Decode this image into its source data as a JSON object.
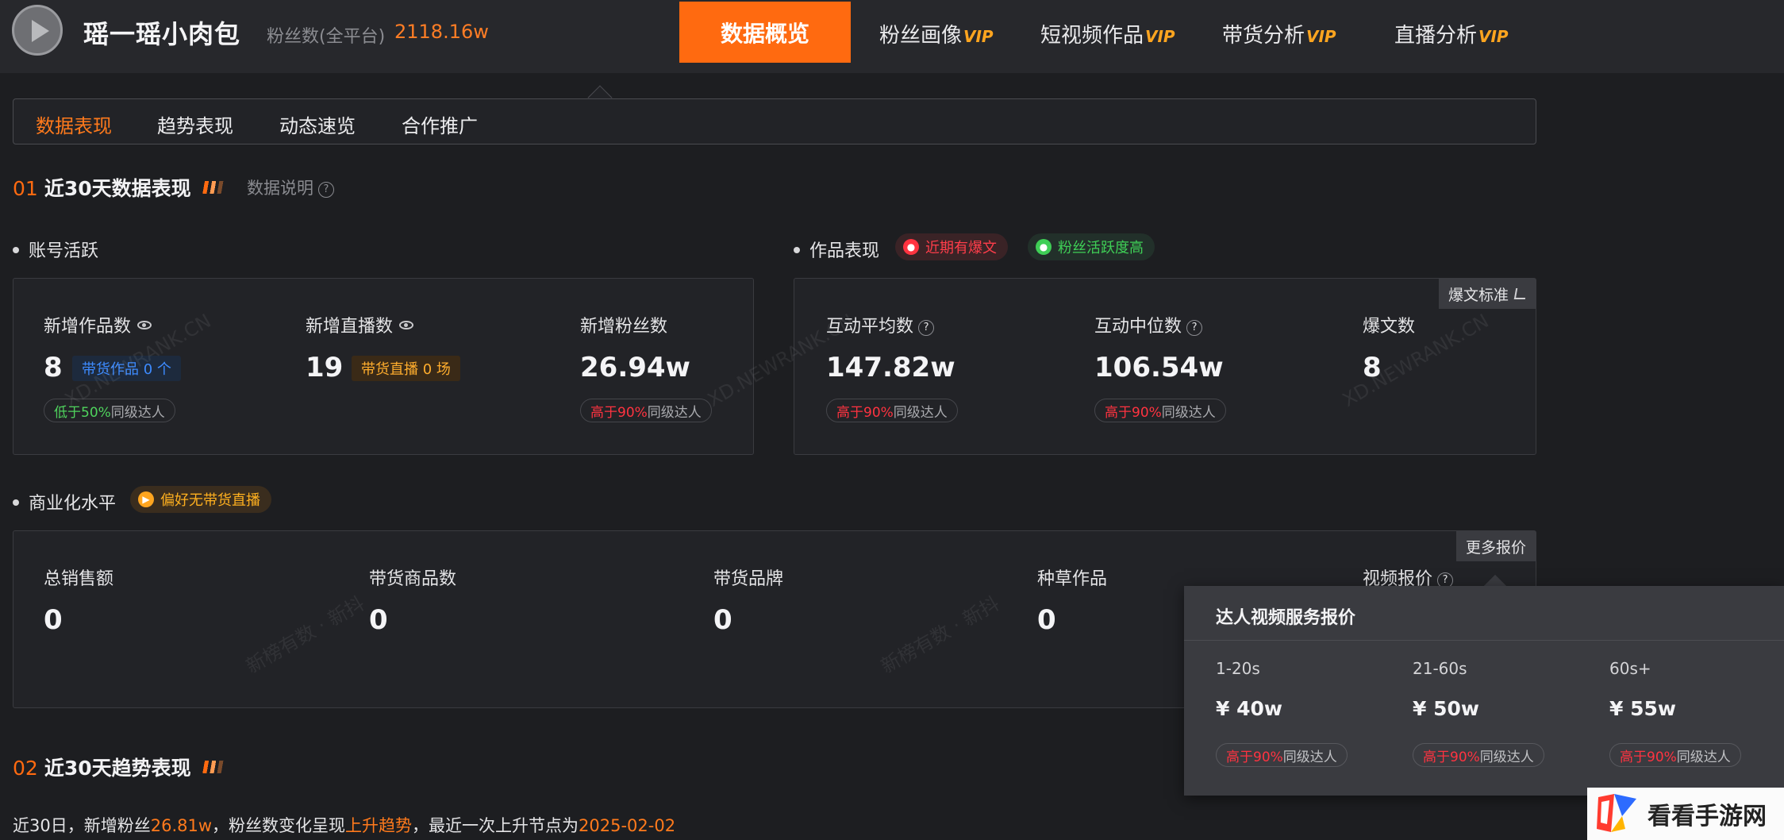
{
  "header": {
    "account_name": "瑶一瑶小肉包",
    "fans_label": "粉丝数(全平台)",
    "fans_value": "2118.16w",
    "nav": [
      {
        "label": "数据概览",
        "vip": ""
      },
      {
        "label": "粉丝画像",
        "vip": "VIP"
      },
      {
        "label": "短视频作品",
        "vip": "VIP"
      },
      {
        "label": "带货分析",
        "vip": "VIP"
      },
      {
        "label": "直播分析",
        "vip": "VIP"
      }
    ]
  },
  "tabs": [
    "数据表现",
    "趋势表现",
    "动态速览",
    "合作推广"
  ],
  "section1": {
    "num": "01",
    "title": "近30天数据表现",
    "note": "数据说明"
  },
  "account_activity": {
    "heading": "账号活跃",
    "metrics": [
      {
        "label": "新增作品数",
        "value": "8",
        "tag": "带货作品 0 个",
        "cmp_hl": "低于50%",
        "cmp_rest": "同级达人"
      },
      {
        "label": "新增直播数",
        "value": "19",
        "tag": "带货直播 0 场"
      },
      {
        "label": "新增粉丝数",
        "value": "26.94w",
        "cmp_hl": "高于90%",
        "cmp_rest": "同级达人"
      }
    ]
  },
  "works": {
    "heading": "作品表现",
    "badges": [
      "近期有爆文",
      "粉丝活跃度高"
    ],
    "corner_button": "爆文标准",
    "metrics": [
      {
        "label": "互动平均数",
        "value": "147.82w",
        "cmp_hl": "高于90%",
        "cmp_rest": "同级达人"
      },
      {
        "label": "互动中位数",
        "value": "106.54w",
        "cmp_hl": "高于90%",
        "cmp_rest": "同级达人"
      },
      {
        "label": "爆文数",
        "value": "8"
      }
    ]
  },
  "commercial": {
    "heading": "商业化水平",
    "badge": "偏好无带货直播",
    "corner_button": "更多报价",
    "metrics": [
      {
        "label": "总销售额",
        "value": "0"
      },
      {
        "label": "带货商品数",
        "value": "0"
      },
      {
        "label": "带货品牌",
        "value": "0"
      },
      {
        "label": "种草作品",
        "value": "0"
      },
      {
        "label": "视频报价"
      }
    ]
  },
  "quote_popover": {
    "title": "达人视频服务报价",
    "items": [
      {
        "range": "1-20s",
        "price": "¥ 40w",
        "cmp_hl": "高于90%",
        "cmp_rest": "同级达人"
      },
      {
        "range": "21-60s",
        "price": "¥ 50w",
        "cmp_hl": "高于90%",
        "cmp_rest": "同级达人"
      },
      {
        "range": "60s+",
        "price": "¥ 55w",
        "cmp_hl": "高于90%",
        "cmp_rest": "同级达人"
      }
    ]
  },
  "section2": {
    "num": "02",
    "title": "近30天趋势表现",
    "summary": {
      "p1": "近30日，新增粉丝",
      "fans": "26.81w",
      "p2": "，粉丝数变化呈现",
      "trend": "上升趋势",
      "p3": "，最近一次上升节点为",
      "date": "2025-02-02"
    }
  },
  "watermarks": [
    "XD.NEWRANK.CN",
    "XD.NEWRANK.CN",
    "XD.NEWRANK.CN",
    "新榜有数 · 新抖",
    "新榜有数 · 新抖"
  ],
  "logo": {
    "text": "看看手游网"
  },
  "colors": {
    "accent": "#ff6a10",
    "vip": "#ffa51f",
    "red": "#ff3340",
    "green": "#4fd35d",
    "blue": "#3d8bff"
  }
}
